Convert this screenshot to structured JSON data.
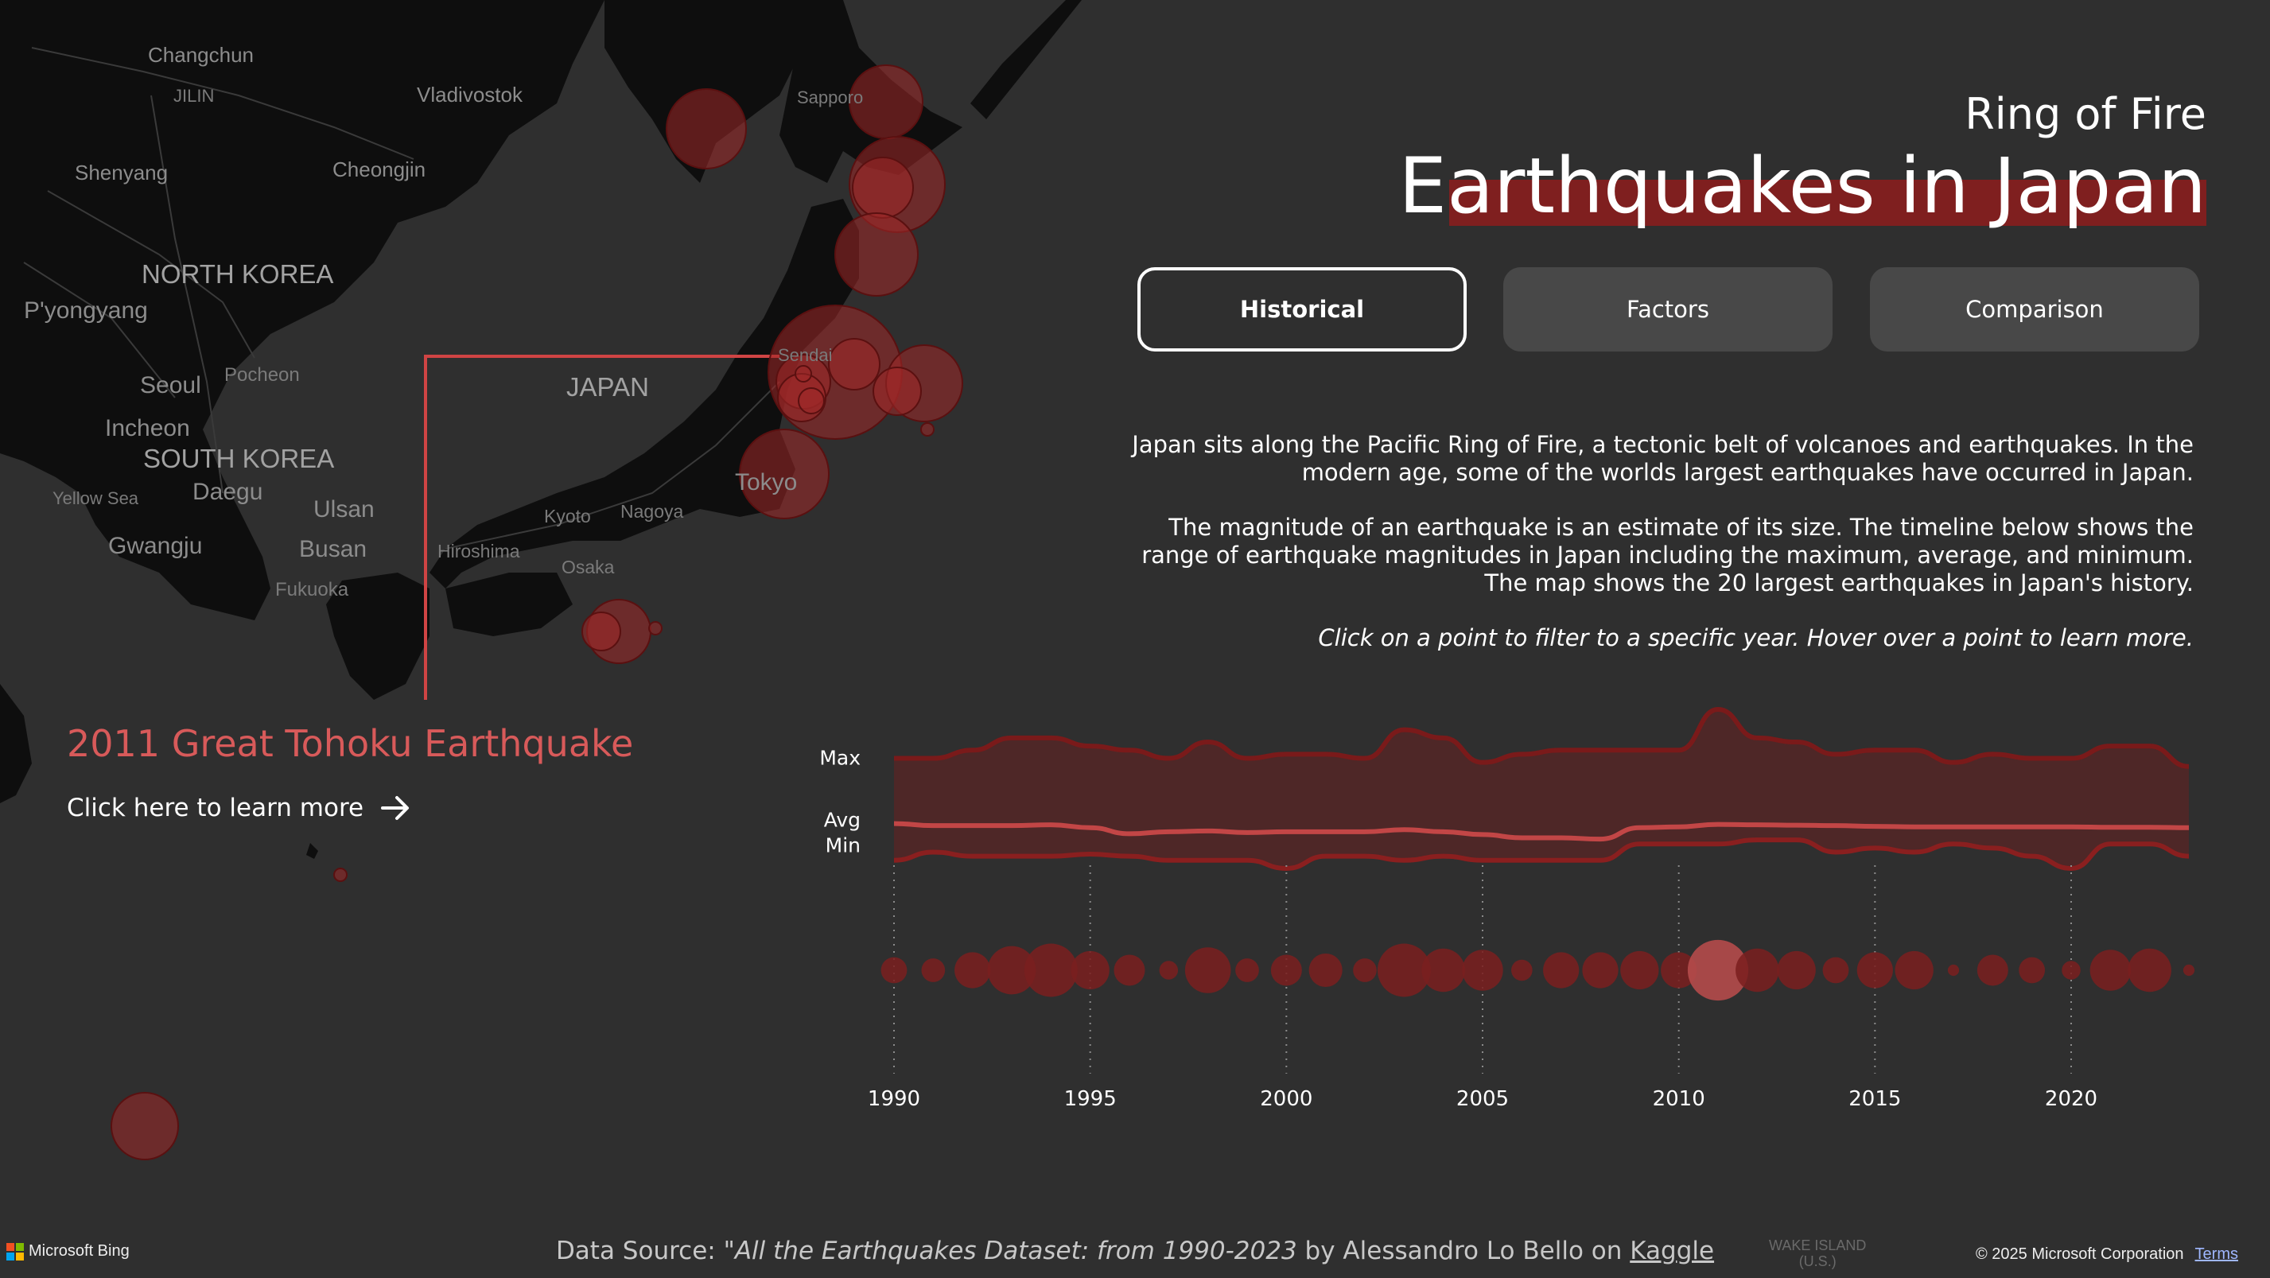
{
  "header": {
    "subtitle": "Ring of Fire",
    "title": "Earthquakes in Japan",
    "accent_color": "#7f1f1f"
  },
  "tabs": [
    {
      "label": "Historical",
      "active": true
    },
    {
      "label": "Factors",
      "active": false
    },
    {
      "label": "Comparison",
      "active": false
    }
  ],
  "description": {
    "p1": "Japan sits along the Pacific Ring of Fire, a tectonic belt of volcanoes and earthquakes. In the modern age, some of the worlds largest earthquakes have occurred in Japan.",
    "p2": "The magnitude of an earthquake is an estimate of its size. The timeline below shows the range of earthquake magnitudes in Japan including the maximum, average, and minimum. The map shows the 20 largest earthquakes in Japan's history.",
    "p3": "Click on a point to filter to a specific year. Hover over a point to learn more."
  },
  "callout": {
    "title": "2011 Great Tohoku Earthquake",
    "link_label": "Click here to learn more",
    "arrow_icon": "arrow-right-icon"
  },
  "map": {
    "labels": {
      "changchun": "Changchun",
      "jilin": "JILIN",
      "vladivostok": "Vladivostok",
      "sapporo": "Sapporo",
      "shenyang": "Shenyang",
      "cheongjin": "Cheongjin",
      "north_korea": "NORTH KOREA",
      "pyongyang": "P'yongyang",
      "seoul": "Seoul",
      "pocheon": "Pocheon",
      "incheon": "Incheon",
      "south_korea": "SOUTH KOREA",
      "japan": "JAPAN",
      "sendai": "Sendai",
      "yellow_sea": "Yellow Sea",
      "daegu": "Daegu",
      "ulsan": "Ulsan",
      "gwangju": "Gwangju",
      "busan": "Busan",
      "fukuoka": "Fukuoka",
      "hiroshima": "Hiroshima",
      "kyoto": "Kyoto",
      "nagoya": "Nagoya",
      "osaka": "Osaka",
      "tokyo": "Tokyo",
      "wake_island_1": "WAKE ISLAND",
      "wake_island_2": "(U.S.)"
    }
  },
  "chart_data": {
    "type": "area",
    "x": [
      1990,
      1991,
      1992,
      1993,
      1994,
      1995,
      1996,
      1997,
      1998,
      1999,
      2000,
      2001,
      2002,
      2003,
      2004,
      2005,
      2006,
      2007,
      2008,
      2009,
      2010,
      2011,
      2012,
      2013,
      2014,
      2015,
      2016,
      2017,
      2018,
      2019,
      2020,
      2021,
      2022,
      2023
    ],
    "series": [
      {
        "name": "Max",
        "values": [
          6.6,
          6.6,
          6.8,
          7.1,
          7.1,
          6.9,
          6.8,
          6.6,
          7.0,
          6.6,
          6.7,
          6.7,
          6.6,
          7.3,
          7.1,
          6.5,
          6.7,
          6.8,
          6.8,
          6.8,
          6.8,
          7.8,
          7.1,
          7.0,
          6.7,
          6.8,
          6.8,
          6.5,
          6.7,
          6.6,
          6.6,
          6.9,
          6.9,
          6.4
        ]
      },
      {
        "name": "Avg",
        "values": [
          5.0,
          4.95,
          4.95,
          4.95,
          4.97,
          4.9,
          4.75,
          4.8,
          4.82,
          4.78,
          4.8,
          4.8,
          4.8,
          4.85,
          4.8,
          4.73,
          4.65,
          4.65,
          4.62,
          4.9,
          4.92,
          4.98,
          4.97,
          4.96,
          4.95,
          4.93,
          4.92,
          4.92,
          4.92,
          4.92,
          4.92,
          4.91,
          4.91,
          4.9
        ]
      },
      {
        "name": "Min",
        "values": [
          4.1,
          4.3,
          4.2,
          4.2,
          4.2,
          4.25,
          4.2,
          4.1,
          4.1,
          4.1,
          3.9,
          4.2,
          4.2,
          4.1,
          4.2,
          4.1,
          4.1,
          4.1,
          4.1,
          4.5,
          4.5,
          4.5,
          4.6,
          4.6,
          4.3,
          4.4,
          4.3,
          4.5,
          4.4,
          4.2,
          3.9,
          4.5,
          4.5,
          4.2
        ]
      }
    ],
    "bubbles": [
      {
        "year": 1990,
        "size": 8
      },
      {
        "year": 1991,
        "size": 7
      },
      {
        "year": 1992,
        "size": 12
      },
      {
        "year": 1993,
        "size": 17
      },
      {
        "year": 1994,
        "size": 19
      },
      {
        "year": 1995,
        "size": 13
      },
      {
        "year": 1996,
        "size": 10
      },
      {
        "year": 1997,
        "size": 5
      },
      {
        "year": 1998,
        "size": 16
      },
      {
        "year": 1999,
        "size": 7
      },
      {
        "year": 2000,
        "size": 10
      },
      {
        "year": 2001,
        "size": 11
      },
      {
        "year": 2002,
        "size": 7
      },
      {
        "year": 2003,
        "size": 19
      },
      {
        "year": 2004,
        "size": 15
      },
      {
        "year": 2005,
        "size": 14
      },
      {
        "year": 2006,
        "size": 6
      },
      {
        "year": 2007,
        "size": 12
      },
      {
        "year": 2008,
        "size": 12
      },
      {
        "year": 2009,
        "size": 13
      },
      {
        "year": 2010,
        "size": 12
      },
      {
        "year": 2011,
        "size": 22,
        "highlight": true
      },
      {
        "year": 2012,
        "size": 15
      },
      {
        "year": 2013,
        "size": 13
      },
      {
        "year": 2014,
        "size": 8
      },
      {
        "year": 2015,
        "size": 12
      },
      {
        "year": 2016,
        "size": 13
      },
      {
        "year": 2017,
        "size": 2
      },
      {
        "year": 2018,
        "size": 10
      },
      {
        "year": 2019,
        "size": 8
      },
      {
        "year": 2020,
        "size": 5
      },
      {
        "year": 2021,
        "size": 14
      },
      {
        "year": 2022,
        "size": 15
      },
      {
        "year": 2023,
        "size": 2
      }
    ],
    "xticks": [
      1990,
      1995,
      2000,
      2005,
      2010,
      2015,
      2020
    ],
    "series_labels": {
      "max": "Max",
      "avg": "Avg",
      "min": "Min"
    },
    "colors": {
      "band": "#5a2525",
      "max": "#7a1a1a",
      "avg": "#c24646",
      "min": "#8a1f1f",
      "bubble": "#7a1f1f",
      "highlight": "#b54b4b"
    }
  },
  "footer": {
    "source_prefix": "Data Source: ",
    "source_quote": "\"All the Earthquakes Dataset: from 1990-2023",
    "source_by": " by Alessandro Lo Bello on ",
    "source_link": "Kaggle",
    "bing_label": "Microsoft Bing",
    "copyright": "© 2025 Microsoft Corporation",
    "terms": "Terms"
  }
}
